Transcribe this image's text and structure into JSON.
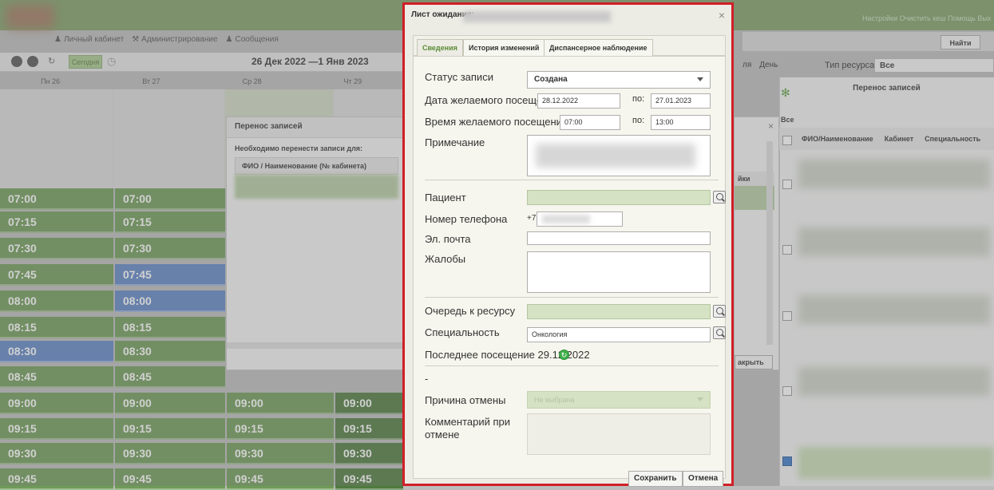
{
  "bg": {
    "top_menu": {
      "cabinet": "Личный кабинет",
      "admin": "Администрирование",
      "messages": "Сообщения"
    },
    "today_label": "Сегодня",
    "date_range": "26 Дек 2022 —1 Янв 2023",
    "days": [
      "Пн 26",
      "Вт 27",
      "Ср 28",
      "Чт 29"
    ],
    "slots_col1": [
      "07:00",
      "07:15",
      "07:30",
      "07:45",
      "08:00",
      "08:15",
      "08:30",
      "08:45",
      "09:00",
      "09:15",
      "09:30",
      "09:45"
    ],
    "slots_col2": [
      "07:00",
      "07:15",
      "07:30",
      "07:45",
      "08:00",
      "08:15",
      "08:30",
      "08:45",
      "09:00",
      "09:15",
      "09:30",
      "09:45"
    ],
    "slots_col3": [
      "09:00",
      "09:15",
      "09:30",
      "09:45"
    ],
    "slots_col4": [
      "09:00",
      "09:15",
      "09:30",
      "09:45"
    ],
    "transfer_dialog": {
      "title": "Перенос записей",
      "subtitle": "Необходимо перенести записи для:",
      "col_header": "ФИО / Наименование (№ кабинета)",
      "partial_col": "йки",
      "close_btn": "акрыть"
    },
    "right": {
      "find_btn": "Найти",
      "view_partial": "ля",
      "view_day": "День",
      "resource_label": "Тип ресурса:",
      "resource_value": "Все",
      "panel_title": "Перенос записей",
      "all_label": "Все",
      "col_fio": "ФИО/Наименование",
      "col_cab": "Кабинет",
      "col_spec": "Специальность",
      "top_links": "Настройки  Очистить кеш  Помощь  Вых"
    }
  },
  "modal": {
    "title": "Лист ожидания:",
    "tabs": [
      "Сведения",
      "История изменений",
      "Диспансерное наблюдение"
    ],
    "status_label": "Статус записи",
    "status_value": "Создана",
    "date_label": "Дата желаемого посещения с:",
    "date_from": "28.12.2022",
    "date_to_label": "по:",
    "date_to": "27.01.2023",
    "time_label": "Время желаемого посещения с:",
    "time_from": "07:00",
    "time_to_label": "по:",
    "time_to": "13:00",
    "note_label": "Примечание",
    "patient_label": "Пациент",
    "phone_label": "Номер телефона",
    "phone_prefix": "+7",
    "email_label": "Эл. почта",
    "complaints_label": "Жалобы",
    "queue_label": "Очередь к ресурсу",
    "specialty_label": "Специальность",
    "specialty_value": "Онкология",
    "last_visit_label": "Последнее посещение",
    "last_visit_value": "29.12.2022",
    "dash": "-",
    "cancel_reason_label": "Причина отмены",
    "cancel_reason_value": "Не выбрана",
    "cancel_comment_label": "Комментарий при отмене",
    "save_btn": "Сохранить",
    "cancel_btn": "Отмена"
  }
}
